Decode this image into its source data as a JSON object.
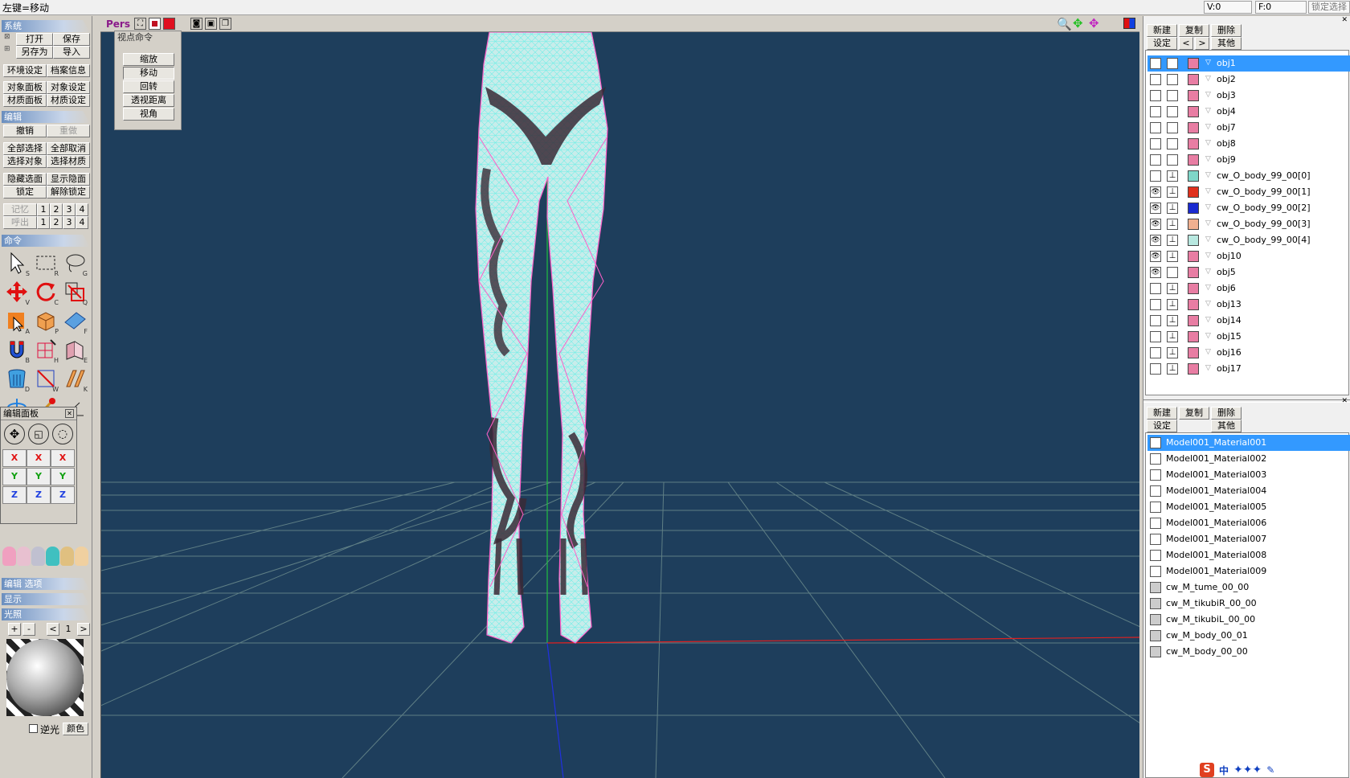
{
  "status": {
    "hint": "左键=移动",
    "v": "V:0",
    "f": "F:0",
    "lock": "锁定选择"
  },
  "sections": {
    "system": "系统",
    "edit": "编辑",
    "command": "命令",
    "edit_options": "编辑 选项",
    "display": "显示",
    "lighting": "光照"
  },
  "system_buttons": {
    "open": "打开",
    "save": "保存",
    "save_as": "另存为",
    "import": "导入",
    "env": "环境设定",
    "file_info": "档案信息",
    "obj_panel": "对象面板",
    "obj_set": "对象设定",
    "mat_panel": "材质面板",
    "mat_set": "材质设定"
  },
  "edit_buttons": {
    "undo": "撤销",
    "redo": "重做",
    "sel_all": "全部选择",
    "desel_all": "全部取消",
    "sel_obj": "选择对象",
    "sel_mat": "选择材质",
    "hide": "隐藏选面",
    "show": "显示隐面",
    "lock": "锁定",
    "unlock": "解除锁定",
    "memo": "记忆",
    "recall": "呼出",
    "n1": "1",
    "n2": "2",
    "n3": "3",
    "n4": "4"
  },
  "edit_panel": {
    "title": "编辑面板",
    "x": "X",
    "y": "Y",
    "z": "Z"
  },
  "lighting": {
    "plus": "+",
    "minus": "-",
    "prev": "<",
    "next": ">",
    "value": "1",
    "backlight": "逆光",
    "color": "颜色"
  },
  "viewport": {
    "mode": "Pers"
  },
  "view_cmd": {
    "title": "视点命令",
    "zoom": "缩放",
    "move": "移动",
    "rotate": "回转",
    "persp": "透视距离",
    "angle": "视角"
  },
  "obj_panel": {
    "new": "新建",
    "copy": "复制",
    "delete": "删除",
    "settings": "设定",
    "prev": "<",
    "next": ">",
    "other": "其他",
    "items": [
      {
        "name": "obj1",
        "color": "#e87da3",
        "eye": false,
        "lock": false,
        "selected": true
      },
      {
        "name": "obj2",
        "color": "#e87da3",
        "eye": false,
        "lock": false
      },
      {
        "name": "obj3",
        "color": "#e87da3",
        "eye": false,
        "lock": false
      },
      {
        "name": "obj4",
        "color": "#e87da3",
        "eye": false,
        "lock": false
      },
      {
        "name": "obj7",
        "color": "#e87da3",
        "eye": false,
        "lock": false
      },
      {
        "name": "obj8",
        "color": "#e87da3",
        "eye": false,
        "lock": false
      },
      {
        "name": "obj9",
        "color": "#e87da3",
        "eye": false,
        "lock": false
      },
      {
        "name": "cw_O_body_99_00[0]",
        "color": "#7fd6c8",
        "eye": false,
        "lock": true
      },
      {
        "name": "cw_O_body_99_00[1]",
        "color": "#e0301c",
        "eye": true,
        "lock": true
      },
      {
        "name": "cw_O_body_99_00[2]",
        "color": "#1a2ad0",
        "eye": true,
        "lock": true
      },
      {
        "name": "cw_O_body_99_00[3]",
        "color": "#f0b090",
        "eye": true,
        "lock": true
      },
      {
        "name": "cw_O_body_99_00[4]",
        "color": "#b8e8e0",
        "eye": true,
        "lock": true
      },
      {
        "name": "obj10",
        "color": "#e87da3",
        "eye": true,
        "lock": true
      },
      {
        "name": "obj5",
        "color": "#e87da3",
        "eye": true,
        "lock": false
      },
      {
        "name": "obj6",
        "color": "#e87da3",
        "eye": false,
        "lock": true
      },
      {
        "name": "obj13",
        "color": "#e87da3",
        "eye": false,
        "lock": true
      },
      {
        "name": "obj14",
        "color": "#e87da3",
        "eye": false,
        "lock": true
      },
      {
        "name": "obj15",
        "color": "#e87da3",
        "eye": false,
        "lock": true
      },
      {
        "name": "obj16",
        "color": "#e87da3",
        "eye": false,
        "lock": true
      },
      {
        "name": "obj17",
        "color": "#e87da3",
        "eye": false,
        "lock": true
      }
    ]
  },
  "mat_panel": {
    "new": "新建",
    "copy": "复制",
    "delete": "删除",
    "settings": "设定",
    "other": "其他",
    "items": [
      {
        "name": "Model001_Material001",
        "selected": true,
        "gray": false
      },
      {
        "name": "Model001_Material002",
        "gray": false
      },
      {
        "name": "Model001_Material003",
        "gray": false
      },
      {
        "name": "Model001_Material004",
        "gray": false
      },
      {
        "name": "Model001_Material005",
        "gray": false
      },
      {
        "name": "Model001_Material006",
        "gray": false
      },
      {
        "name": "Model001_Material007",
        "gray": false
      },
      {
        "name": "Model001_Material008",
        "gray": false
      },
      {
        "name": "Model001_Material009",
        "gray": false
      },
      {
        "name": "cw_M_tume_00_00",
        "gray": true
      },
      {
        "name": "cw_M_tikubiR_00_00",
        "gray": true
      },
      {
        "name": "cw_M_tikubiL_00_00",
        "gray": true
      },
      {
        "name": "cw_M_body_00_01",
        "gray": true
      },
      {
        "name": "cw_M_body_00_00",
        "gray": true
      }
    ]
  },
  "tray": {
    "ime": "中"
  },
  "colors": {
    "viewport_bg": "#1e3e5c",
    "selection": "#3399ff",
    "wire": "#7ff5ee",
    "wire_pink": "#ff5fc8"
  }
}
